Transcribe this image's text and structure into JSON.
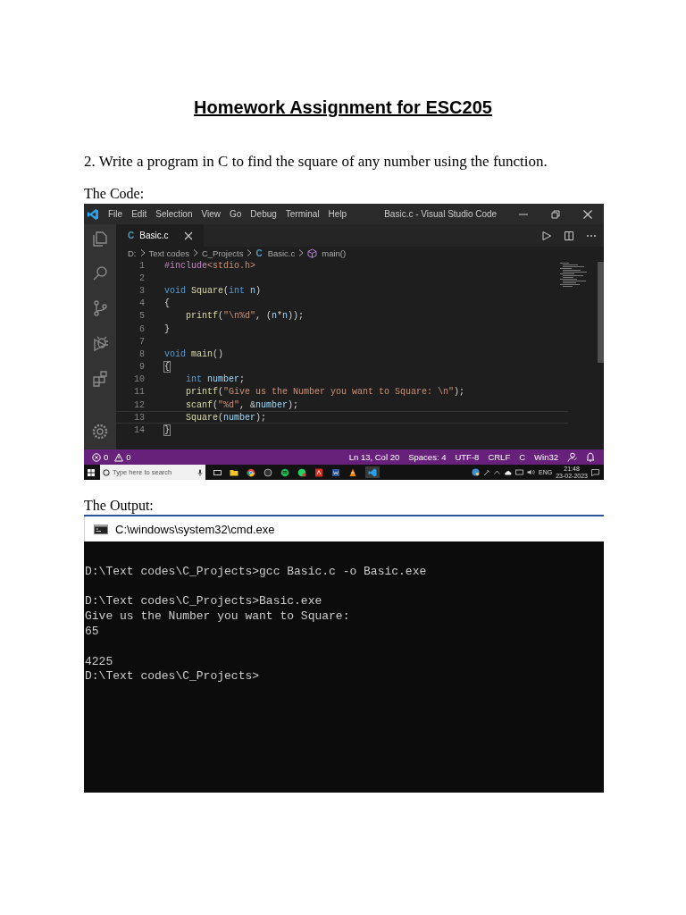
{
  "document": {
    "title": "Homework Assignment for ESC205",
    "question": "2. Write a program in C to find the square of any number using the function.",
    "code_heading": "The Code:",
    "output_heading": "The Output:"
  },
  "vscode": {
    "menu": [
      "File",
      "Edit",
      "Selection",
      "View",
      "Go",
      "Debug",
      "Terminal",
      "Help"
    ],
    "title": "Basic.c - Visual Studio Code",
    "tabs": [
      {
        "icon_text": "C",
        "label": "Basic.c",
        "selected": true
      }
    ],
    "breadcrumbs": [
      {
        "kind": "folder",
        "label": "D:"
      },
      {
        "kind": "folder",
        "label": "Text codes"
      },
      {
        "kind": "folder",
        "label": "C_Projects"
      },
      {
        "kind": "file",
        "icon_text": "C",
        "label": "Basic.c"
      },
      {
        "kind": "symbol",
        "label": "main()"
      }
    ],
    "lines": [
      {
        "number": "1",
        "current": false,
        "tokens": [
          {
            "kind": "pre",
            "text": "#include"
          },
          {
            "kind": "str",
            "text": "<stdio.h>"
          }
        ]
      },
      {
        "number": "2",
        "current": false
      },
      {
        "number": "3",
        "current": false,
        "tokens": [
          {
            "kind": "kw",
            "text": "void "
          },
          {
            "kind": "fn",
            "text": "Square"
          },
          {
            "kind": "plain",
            "text": "("
          },
          {
            "kind": "kw",
            "text": "int "
          },
          {
            "kind": "var",
            "text": "n"
          },
          {
            "kind": "plain",
            "text": ")"
          }
        ]
      },
      {
        "number": "4",
        "current": false,
        "tokens": [
          {
            "kind": "plain",
            "text": "{"
          }
        ]
      },
      {
        "number": "5",
        "current": false,
        "tokens": [
          {
            "kind": "fn",
            "text": "    printf"
          },
          {
            "kind": "plain",
            "text": "("
          },
          {
            "kind": "str",
            "text": "\"\\n%d\""
          },
          {
            "kind": "plain",
            "text": ", ("
          },
          {
            "kind": "var",
            "text": "n"
          },
          {
            "kind": "plain",
            "text": "*"
          },
          {
            "kind": "var",
            "text": "n"
          },
          {
            "kind": "plain",
            "text": "));"
          }
        ]
      },
      {
        "number": "6",
        "current": false,
        "tokens": [
          {
            "kind": "plain",
            "text": "}"
          }
        ]
      },
      {
        "number": "7",
        "current": false
      },
      {
        "number": "8",
        "current": false,
        "tokens": [
          {
            "kind": "kw",
            "text": "void "
          },
          {
            "kind": "fn",
            "text": "main"
          },
          {
            "kind": "plain",
            "text": "()"
          }
        ]
      },
      {
        "number": "9",
        "current": false,
        "tokens": [
          {
            "kind": "bracket",
            "text": "{"
          }
        ]
      },
      {
        "number": "10",
        "current": false,
        "tokens": [
          {
            "kind": "kw",
            "text": "    int "
          },
          {
            "kind": "var",
            "text": "number"
          },
          {
            "kind": "plain",
            "text": ";"
          }
        ]
      },
      {
        "number": "11",
        "current": false,
        "tokens": [
          {
            "kind": "fn",
            "text": "    printf"
          },
          {
            "kind": "plain",
            "text": "("
          },
          {
            "kind": "str",
            "text": "\"Give us the Number you want to Square: \\n\""
          },
          {
            "kind": "plain",
            "text": ");"
          }
        ]
      },
      {
        "number": "12",
        "current": false,
        "tokens": [
          {
            "kind": "fn",
            "text": "    scanf"
          },
          {
            "kind": "plain",
            "text": "("
          },
          {
            "kind": "str",
            "text": "\"%d\""
          },
          {
            "kind": "plain",
            "text": ", &"
          },
          {
            "kind": "var",
            "text": "number"
          },
          {
            "kind": "plain",
            "text": ");"
          }
        ]
      },
      {
        "number": "13",
        "current": true,
        "tokens": [
          {
            "kind": "fn",
            "text": "    Square"
          },
          {
            "kind": "plain",
            "text": "("
          },
          {
            "kind": "var",
            "text": "number"
          },
          {
            "kind": "plain",
            "text": ");"
          }
        ]
      },
      {
        "number": "14",
        "current": false,
        "tokens": [
          {
            "kind": "bracket",
            "text": "}"
          }
        ]
      }
    ],
    "status_bar": {
      "errors": "0",
      "warnings": "0",
      "items": [
        "Ln 13, Col 20",
        "Spaces: 4",
        "UTF-8",
        "CRLF",
        "C",
        "Win32"
      ]
    },
    "taskbar": {
      "search_placeholder": "Type here to search",
      "language": "ENG",
      "time": "21:48",
      "date": "23-02-2023"
    }
  },
  "console": {
    "title": "C:\\windows\\system32\\cmd.exe",
    "blocks": [
      [
        "D:\\Text codes\\C_Projects>gcc Basic.c -o Basic.exe"
      ],
      [
        "D:\\Text codes\\C_Projects>Basic.exe",
        "Give us the Number you want to Square:",
        "65"
      ],
      [
        "4225",
        "D:\\Text codes\\C_Projects>"
      ]
    ]
  }
}
